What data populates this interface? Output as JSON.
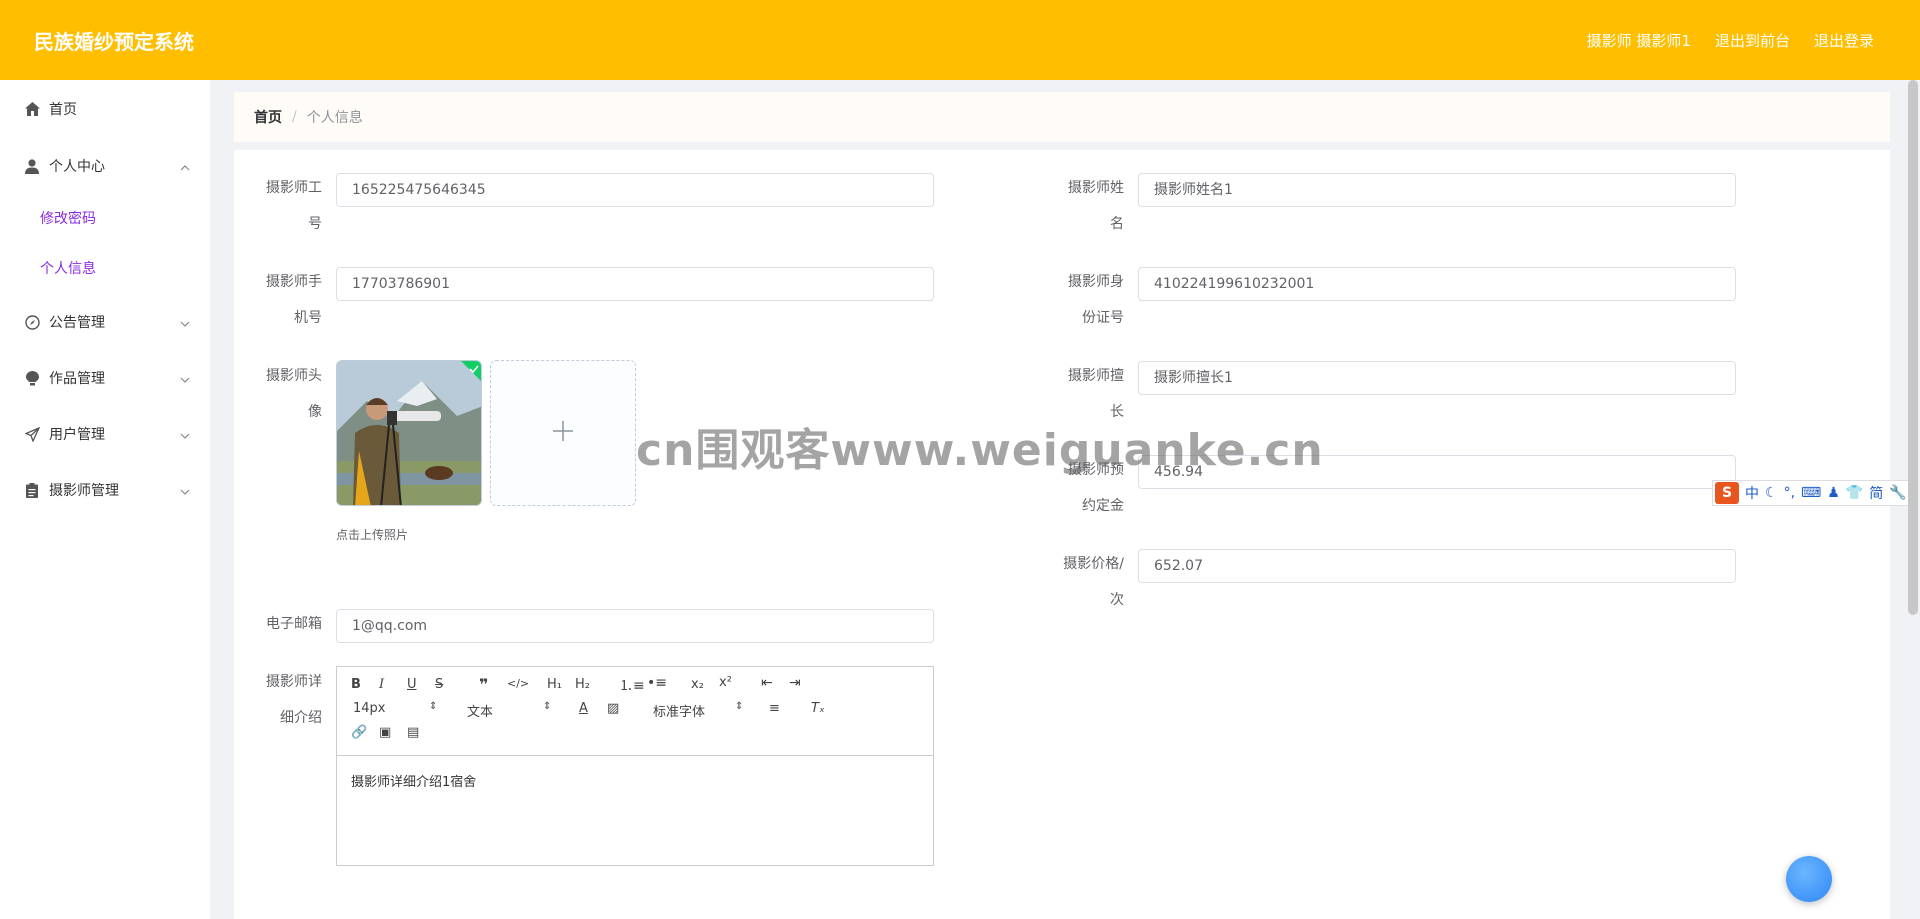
{
  "header": {
    "app_title": "民族婚纱预定系统",
    "user_label": "摄影师 摄影师1",
    "front_link": "退出到前台",
    "logout_link": "退出登录"
  },
  "sidebar": {
    "items": [
      {
        "label": "首页",
        "icon": "home-icon"
      },
      {
        "label": "个人中心",
        "icon": "user-icon",
        "expanded": true,
        "children": [
          {
            "label": "修改密码"
          },
          {
            "label": "个人信息"
          }
        ]
      },
      {
        "label": "公告管理",
        "icon": "compass-icon"
      },
      {
        "label": "作品管理",
        "icon": "lightbulb-icon"
      },
      {
        "label": "用户管理",
        "icon": "send-icon"
      },
      {
        "label": "摄影师管理",
        "icon": "clipboard-icon"
      }
    ]
  },
  "breadcrumb": {
    "home": "首页",
    "separator": "/",
    "current": "个人信息"
  },
  "form": {
    "worker_id": {
      "label": "摄影师工号",
      "value": "165225475646345"
    },
    "name": {
      "label": "摄影师姓名",
      "value": "摄影师姓名1"
    },
    "phone": {
      "label": "摄影师手机号",
      "value": "17703786901"
    },
    "id_card": {
      "label": "摄影师身份证号",
      "value": "410224199610232001"
    },
    "avatar": {
      "label": "摄影师头像",
      "upload_tip": "点击上传照片",
      "uploaded": true
    },
    "specialty": {
      "label": "摄影师擅长",
      "value": "摄影师擅长1"
    },
    "deposit": {
      "label": "摄影师预约定金",
      "value": "456.94"
    },
    "price": {
      "label": "摄影价格/次",
      "value": "652.07"
    },
    "email": {
      "label": "电子邮箱",
      "value": "1@qq.com"
    },
    "intro": {
      "label": "摄影师详细介绍",
      "content": "摄影师详细介绍1宿舍",
      "font_size": "14px",
      "block_type": "文本",
      "font_family": "标准字体"
    }
  },
  "overlay": {
    "watermark": "cn围观客www.weiguanke.cn",
    "ime_s": "S",
    "ime_mode": "中",
    "ime_simplified": "简"
  },
  "colors": {
    "header": "#ffbf00",
    "submenu_active": "#8a2be2",
    "float_button": "#2f87f5"
  }
}
